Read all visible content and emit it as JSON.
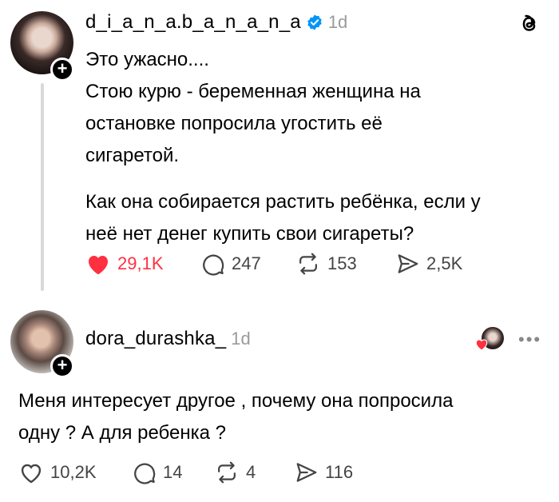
{
  "colors": {
    "like_red": "#ff3040",
    "verified_blue": "#0095f6",
    "muted": "#9a9a9a"
  },
  "post": {
    "username": "d_i_a_n_a.b_a_n_a_n_a",
    "verified": true,
    "time": "1d",
    "text_lines": [
      "Это ужасно....",
      "Стою курю - беременная женщина на",
      "остановке попросила угостить её",
      "сигаретой.",
      "Как она собирается растить ребёнка, если у",
      "неё нет денег купить свои сигареты?"
    ],
    "likes": "29,1K",
    "comments": "247",
    "reposts": "153",
    "shares": "2,5K",
    "liked": true
  },
  "reply": {
    "username": "dora_durashka_",
    "time": "1d",
    "text_lines": [
      "Меня интересует другое , почему она попросила",
      "одну ? А для ребенка ?"
    ],
    "likes": "10,2K",
    "comments": "14",
    "reposts": "4",
    "shares": "116"
  }
}
